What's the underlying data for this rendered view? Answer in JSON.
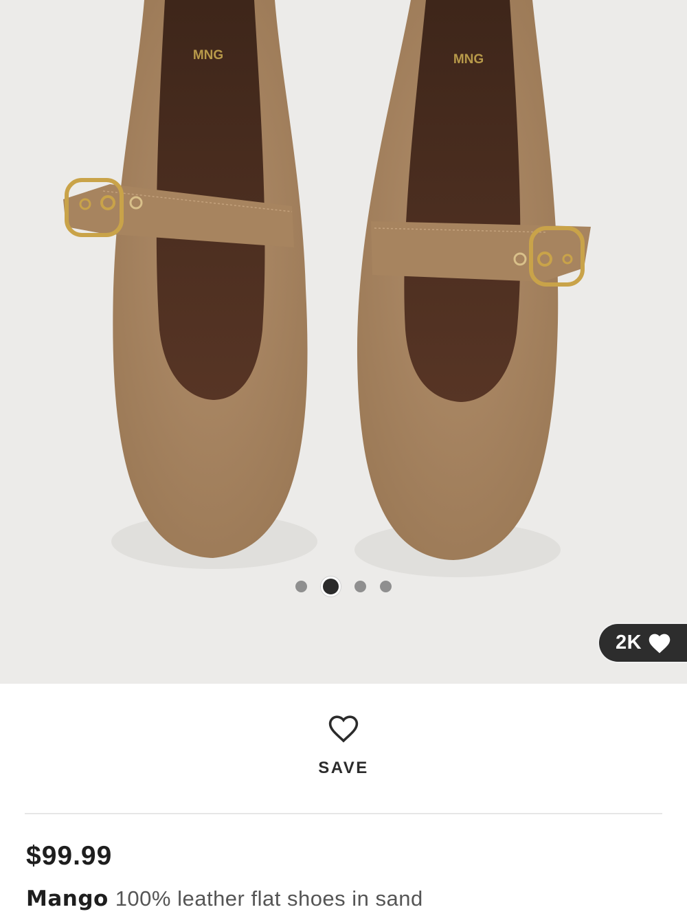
{
  "gallery": {
    "image_alt": "Mango 100% leather flat shoes in sand",
    "logo_text": "MNG",
    "total_images": 4,
    "active_index": 1,
    "likes": "2K",
    "colors": {
      "suede": "#a98764",
      "lining": "#4a2e20",
      "buckle": "#c9a349",
      "background": "#ecebe9"
    }
  },
  "save": {
    "label": "SAVE",
    "icon": "heart-outline-icon"
  },
  "product": {
    "price": "$99.99",
    "brand": "Mango",
    "name": "100% leather flat shoes in sand"
  }
}
